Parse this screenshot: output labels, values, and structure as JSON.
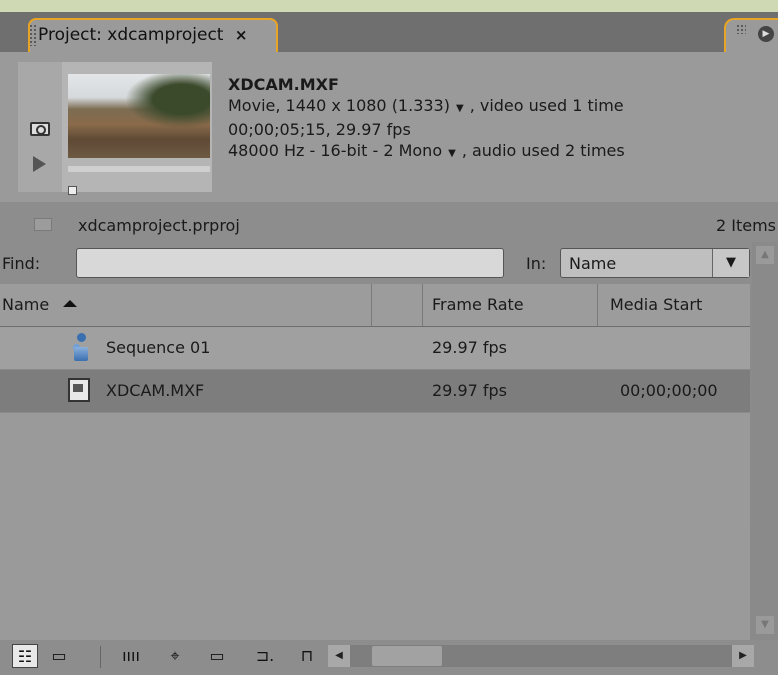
{
  "tab": {
    "title": "Project: xdcamproject",
    "close_glyph": "×",
    "menu_glyph": "▶"
  },
  "preview": {
    "clip_name": "XDCAM.MXF",
    "video_info": "Movie, 1440 x 1080 (1.333)",
    "video_usage": ", video used 1 time",
    "timecode_info": "00;00;05;15, 29.97 fps",
    "audio_info": "48000 Hz - 16-bit - 2 Mono",
    "audio_usage": ", audio used 2 times",
    "dropdown_glyph": "▼"
  },
  "project": {
    "file_name": "xdcamproject.prproj",
    "items_count": "2 Items"
  },
  "find": {
    "label": "Find:",
    "value": "",
    "in_label": "In:",
    "in_value": "Name",
    "in_arrow": "▼"
  },
  "table": {
    "columns": [
      "Name",
      "Frame Rate",
      "Media Start"
    ],
    "rows": [
      {
        "name": "Sequence 01",
        "frame_rate": "29.97 fps",
        "media_start": "",
        "icon": "sequence-icon"
      },
      {
        "name": "XDCAM.MXF",
        "frame_rate": "29.97 fps",
        "media_start": "00;00;00;00",
        "icon": "movie-clip-icon"
      }
    ]
  },
  "scrollbar": {
    "up": "▲",
    "down": "▼",
    "left": "◀",
    "right": "▶"
  },
  "toolbar": {
    "list_view": "☷",
    "icon_view": "▭",
    "automate": "ıııı",
    "find": "⌖",
    "new_bin": "▭",
    "new_item": "⊐.",
    "delete": "⊓"
  }
}
